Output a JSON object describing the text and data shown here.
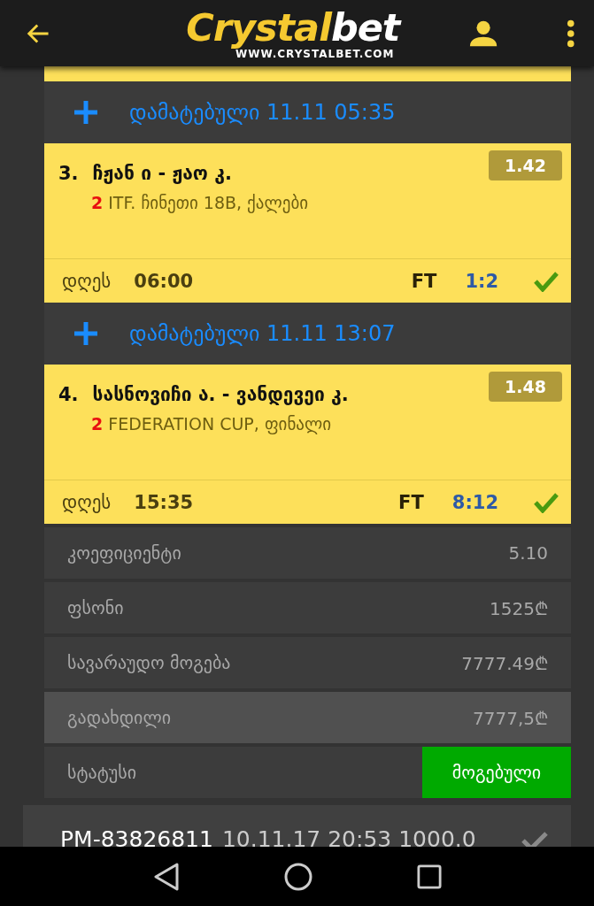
{
  "header": {
    "logo_part_1": "Crystal",
    "logo_part_2": "bet",
    "logo_url": "WWW.CRYSTALBET.COM"
  },
  "items": [
    {
      "kind": "cut"
    },
    {
      "kind": "added",
      "label": "დამატებული",
      "datetime": "11.11 05:35"
    },
    {
      "kind": "match",
      "number": "3.",
      "teams": "ჩჟან ი - ჟაო კ.",
      "odds": "1.42",
      "period": "2",
      "league": "ITF. ჩინეთი 18B, ქალები",
      "day": "დღეს",
      "time": "06:00",
      "status": "FT",
      "score": "1:2",
      "won": true
    },
    {
      "kind": "added",
      "label": "დამატებული",
      "datetime": "11.11 13:07"
    },
    {
      "kind": "match",
      "number": "4.",
      "teams": "სასნოვიჩი ა. - ვანდევეი კ.",
      "odds": "1.48",
      "period": "2",
      "league": "FEDERATION CUP, ფინალი",
      "day": "დღეს",
      "time": "15:35",
      "status": "FT",
      "score": "8:12",
      "won": true
    }
  ],
  "summary": [
    {
      "kind": "value",
      "label": "კოეფიციენტი",
      "value": "5.10",
      "highlighted": false
    },
    {
      "kind": "value",
      "label": "ფსონი",
      "value": "1525",
      "currency": "₾",
      "highlighted": false
    },
    {
      "kind": "value",
      "label": "სავარაუდო მოგება",
      "value": "7777.49",
      "currency": "₾",
      "highlighted": false
    },
    {
      "kind": "value",
      "label": "გადახდილი",
      "value": "7777,5",
      "currency": "₾",
      "highlighted": true
    },
    {
      "kind": "badge",
      "label": "სტატუსი",
      "value": "მოგებული",
      "color": "#00aa00"
    }
  ],
  "ticket": {
    "id": "PM-83826811",
    "details": "10.11.17 20:53 1000.0",
    "checked": true
  }
}
